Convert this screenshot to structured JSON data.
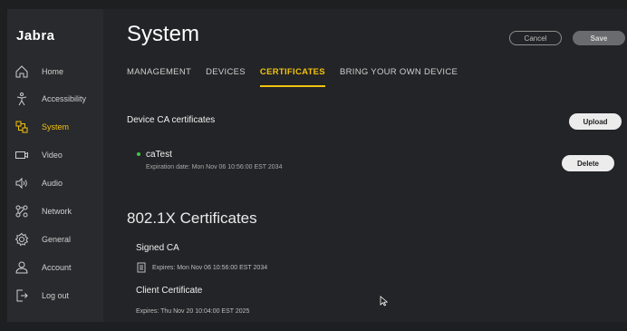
{
  "app": {
    "logo": "Jabra"
  },
  "sidebar": {
    "items": [
      {
        "label": "Home",
        "icon": "home-icon"
      },
      {
        "label": "Accessibility",
        "icon": "accessibility-icon"
      },
      {
        "label": "System",
        "icon": "system-icon",
        "active": true
      },
      {
        "label": "Video",
        "icon": "video-icon"
      },
      {
        "label": "Audio",
        "icon": "speaker-icon"
      },
      {
        "label": "Network",
        "icon": "network-icon"
      },
      {
        "label": "General",
        "icon": "gear-icon"
      },
      {
        "label": "Account",
        "icon": "user-icon"
      },
      {
        "label": "Log out",
        "icon": "logout-icon"
      }
    ]
  },
  "header": {
    "title": "System",
    "cancel_label": "Cancel",
    "save_label": "Save"
  },
  "tabs": [
    {
      "label": "MANAGEMENT"
    },
    {
      "label": "DEVICES"
    },
    {
      "label": "CERTIFICATES",
      "active": true
    },
    {
      "label": "BRING YOUR OWN DEVICE"
    }
  ],
  "device_ca": {
    "title": "Device CA certificates",
    "upload_label": "Upload",
    "cert": {
      "name": "caTest",
      "expiration": "Expiration date: Mon Nov 06 10:56:00 EST 2034",
      "delete_label": "Delete"
    }
  },
  "dot1x": {
    "title": "802.1X Certificates",
    "signed_ca": {
      "label": "Signed CA",
      "expires": "Expires: Mon Nov 06 10:56:00 EST 2034"
    },
    "client_cert": {
      "label": "Client Certificate",
      "expires": "Expires: Thu Nov 20 10:04:00 EST 2025"
    }
  },
  "colors": {
    "accent": "#f2c20f",
    "status_ok": "#3fc447",
    "bg": "#232427",
    "sidebar": "#292a2d"
  }
}
